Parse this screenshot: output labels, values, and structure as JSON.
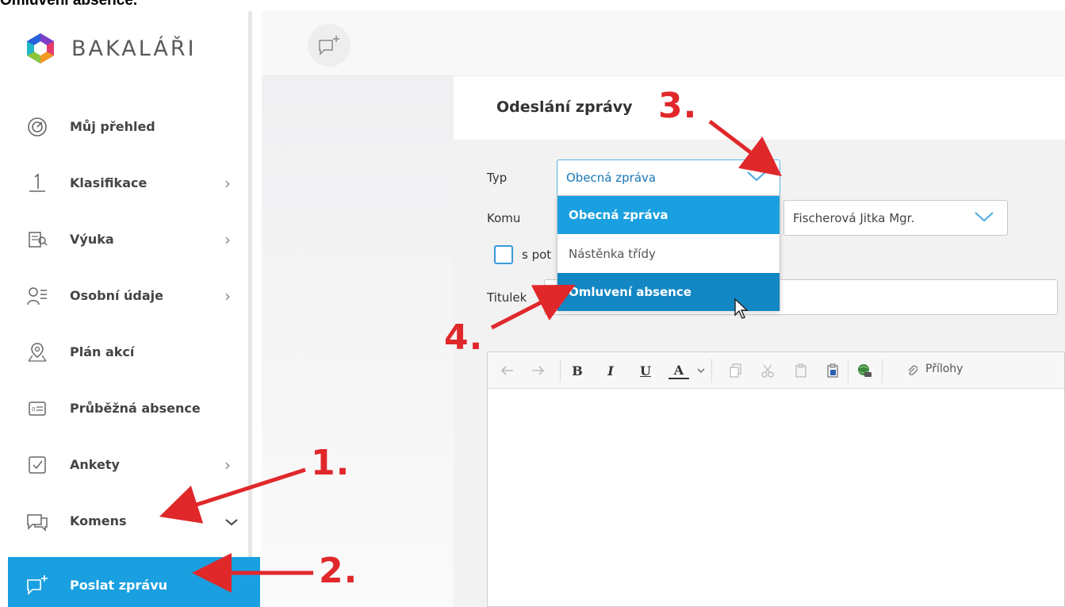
{
  "caption": "Omluvení absence.",
  "app": {
    "logo_text": "BAKALÁŘI"
  },
  "sidebar": {
    "items": [
      {
        "label": "Můj přehled",
        "icon": "dashboard-icon",
        "chevron": ""
      },
      {
        "label": "Klasifikace",
        "icon": "grade-icon",
        "chevron": ">"
      },
      {
        "label": "Výuka",
        "icon": "book-icon",
        "chevron": ">"
      },
      {
        "label": "Osobní údaje",
        "icon": "person-icon",
        "chevron": ">"
      },
      {
        "label": "Plán akcí",
        "icon": "map-pin-icon",
        "chevron": ""
      },
      {
        "label": "Průběžná absence",
        "icon": "id-card-icon",
        "chevron": ""
      },
      {
        "label": "Ankety",
        "icon": "checkbox-icon",
        "chevron": ">"
      },
      {
        "label": "Komens",
        "icon": "chat-icon",
        "chevron": "v"
      }
    ],
    "active": {
      "label": "Poslat zprávu",
      "icon": "new-message-icon"
    }
  },
  "panel": {
    "title": "Odeslání zprávy",
    "type_label": "Typ",
    "type_value": "Obecná zpráva",
    "to_label": "Komu",
    "to_value": "Fischerová Jitka Mgr.",
    "checkbox_label": "s pot",
    "title_label": "Titulek",
    "title_value": ""
  },
  "dropdown": {
    "options": [
      "Obecná zpráva",
      "Nástěnka třídy",
      "Omluvení absence"
    ]
  },
  "toolbar": {
    "bold": "B",
    "italic": "I",
    "underline": "U",
    "font_color": "A",
    "attachments": "Přílohy"
  },
  "annotations": {
    "step1": "1.",
    "step2": "2.",
    "step3": "3.",
    "step4": "4."
  },
  "colors": {
    "accent": "#1aa0e0",
    "annotation": "#e0282b"
  }
}
